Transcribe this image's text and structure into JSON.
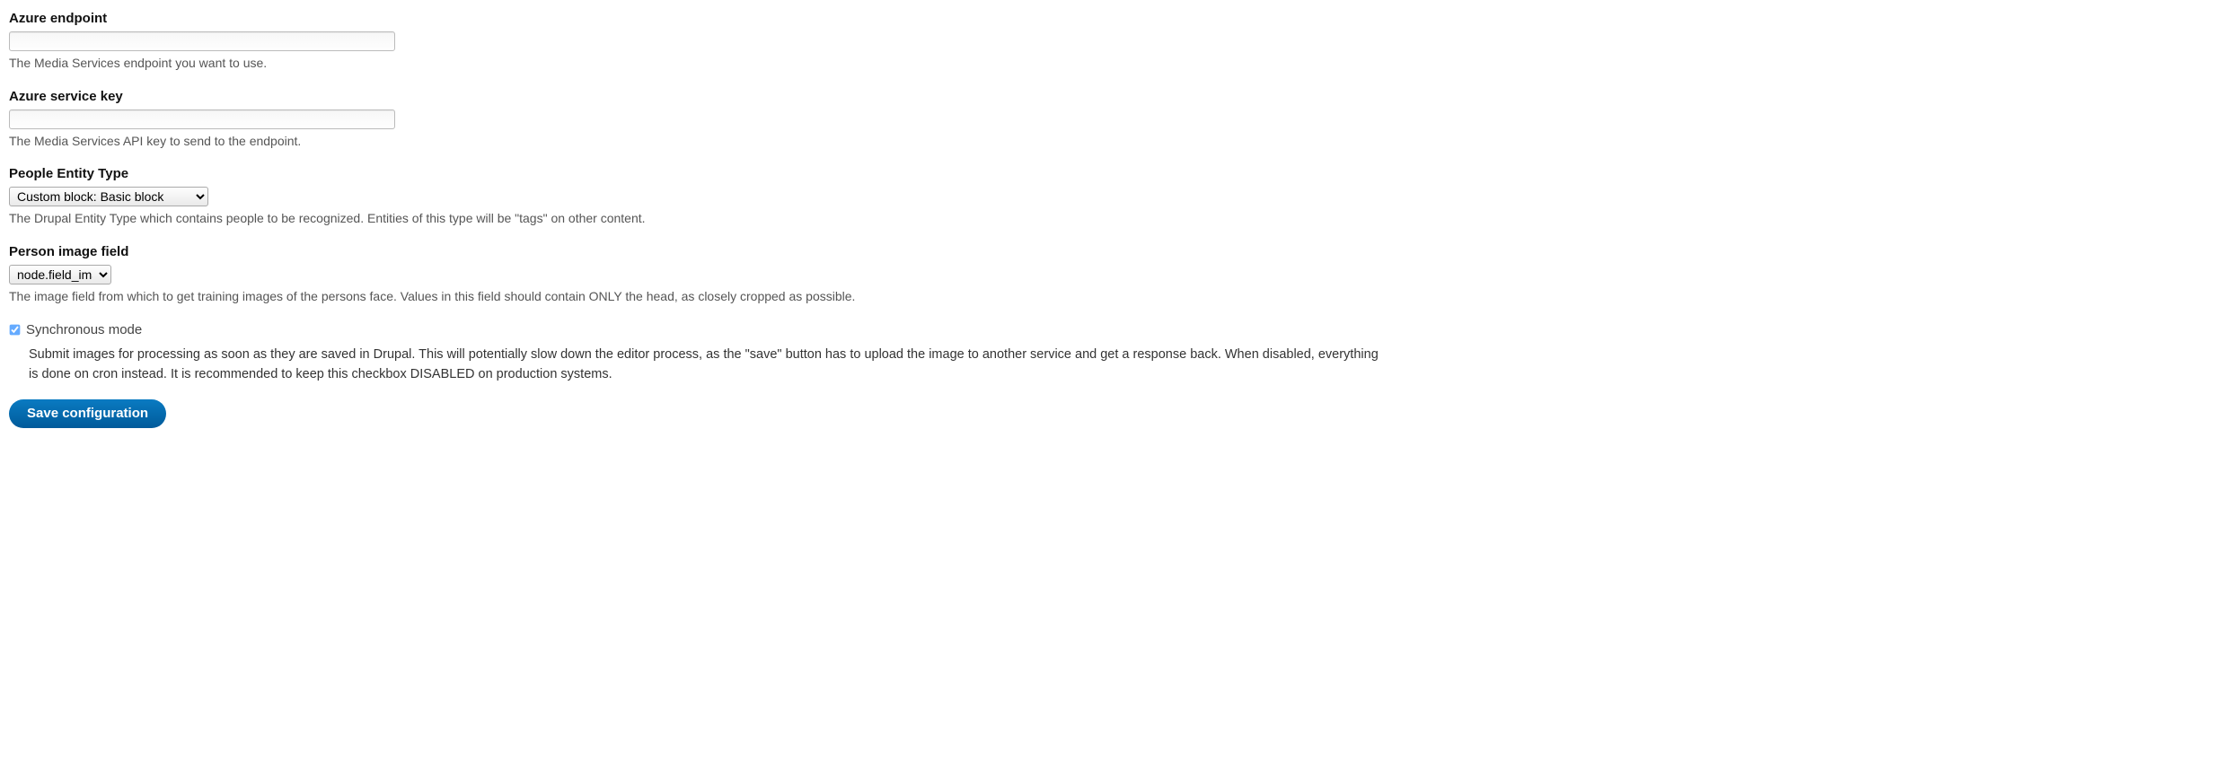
{
  "azure_endpoint": {
    "label": "Azure endpoint",
    "value": "",
    "description": "The Media Services endpoint you want to use."
  },
  "azure_service_key": {
    "label": "Azure service key",
    "value": "",
    "description": "The Media Services API key to send to the endpoint."
  },
  "people_entity_type": {
    "label": "People Entity Type",
    "selected": "Custom block: Basic block",
    "description": "The Drupal Entity Type which contains people to be recognized. Entities of this type will be \"tags\" on other content."
  },
  "person_image_field": {
    "label": "Person image field",
    "selected": "node.field_image",
    "description": "The image field from which to get training images of the persons face. Values in this field should contain ONLY the head, as closely cropped as possible."
  },
  "synchronous_mode": {
    "label": "Synchronous mode",
    "checked": true,
    "description": "Submit images for processing as soon as they are saved in Drupal. This will potentially slow down the editor process, as the \"save\" button has to upload the image to another service and get a response back. When disabled, everything is done on cron instead. It is recommended to keep this checkbox DISABLED on production systems."
  },
  "submit": {
    "label": "Save configuration"
  }
}
